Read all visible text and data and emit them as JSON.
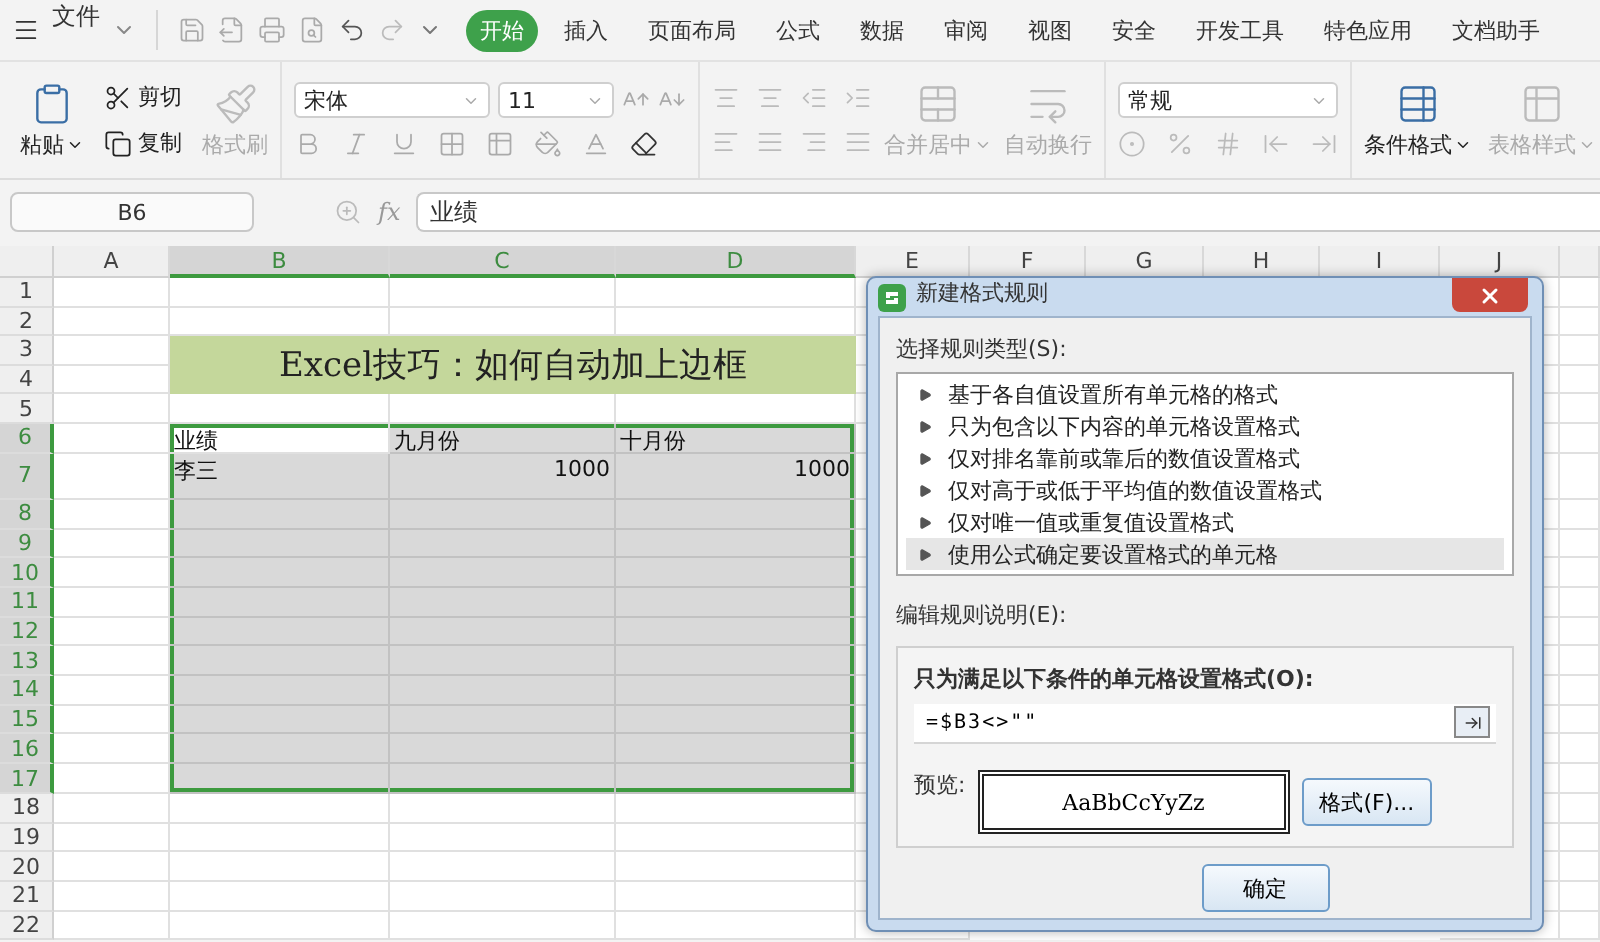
{
  "menu": {
    "file_label": "文件",
    "tabs": [
      {
        "label": "开始",
        "selected": true
      },
      {
        "label": "插入",
        "selected": false
      },
      {
        "label": "页面布局",
        "selected": false
      },
      {
        "label": "公式",
        "selected": false
      },
      {
        "label": "数据",
        "selected": false
      },
      {
        "label": "审阅",
        "selected": false
      },
      {
        "label": "视图",
        "selected": false
      },
      {
        "label": "安全",
        "selected": false
      },
      {
        "label": "开发工具",
        "selected": false
      },
      {
        "label": "特色应用",
        "selected": false
      },
      {
        "label": "文档助手",
        "selected": false
      }
    ]
  },
  "ribbon": {
    "paste": {
      "label": "粘贴",
      "disabled": false
    },
    "cut": {
      "label": "剪切",
      "disabled": false
    },
    "copy": {
      "label": "复制",
      "disabled": false
    },
    "format_painter": {
      "label": "格式刷",
      "disabled": true
    },
    "font_name": "宋体",
    "font_size": "11",
    "merge_center": {
      "label": "合并居中",
      "disabled": true
    },
    "wrap_text": {
      "label": "自动换行",
      "disabled": true
    },
    "number_format": "常规",
    "conditional_format": {
      "label": "条件格式",
      "disabled": false
    },
    "table_style": {
      "label": "表格样式",
      "disabled": true
    }
  },
  "formula_bar": {
    "name_box": "B6",
    "fx": "fx",
    "content": "业绩"
  },
  "sheet": {
    "columns": [
      {
        "label": "A",
        "selected": false
      },
      {
        "label": "B",
        "selected": true
      },
      {
        "label": "C",
        "selected": true
      },
      {
        "label": "D",
        "selected": true
      },
      {
        "label": "E",
        "selected": false
      },
      {
        "label": "F",
        "selected": false
      },
      {
        "label": "G",
        "selected": false
      },
      {
        "label": "H",
        "selected": false
      },
      {
        "label": "I",
        "selected": false
      },
      {
        "label": "J",
        "selected": false
      }
    ],
    "rows": [
      {
        "label": "1",
        "selected": false
      },
      {
        "label": "2",
        "selected": false
      },
      {
        "label": "3",
        "selected": false
      },
      {
        "label": "4",
        "selected": false
      },
      {
        "label": "5",
        "selected": false
      },
      {
        "label": "6",
        "selected": true
      },
      {
        "label": "7",
        "selected": true
      },
      {
        "label": "8",
        "selected": true
      },
      {
        "label": "9",
        "selected": true
      },
      {
        "label": "10",
        "selected": true
      },
      {
        "label": "11",
        "selected": true
      },
      {
        "label": "12",
        "selected": true
      },
      {
        "label": "13",
        "selected": true
      },
      {
        "label": "14",
        "selected": true
      },
      {
        "label": "15",
        "selected": true
      },
      {
        "label": "16",
        "selected": true
      },
      {
        "label": "17",
        "selected": true
      },
      {
        "label": "18",
        "selected": false
      },
      {
        "label": "19",
        "selected": false
      },
      {
        "label": "20",
        "selected": false
      },
      {
        "label": "21",
        "selected": false
      },
      {
        "label": "22",
        "selected": false
      }
    ],
    "banner": "Excel技巧：如何自动加上边框",
    "table": {
      "header": [
        "业绩",
        "九月份",
        "十月份"
      ],
      "rows": [
        {
          "cells": [
            "李三",
            "1000",
            "1000"
          ]
        }
      ]
    }
  },
  "dialog": {
    "title": "新建格式规则",
    "rule_type_label": "选择规则类型(S):",
    "rule_types": [
      {
        "label": "基于各自值设置所有单元格的格式",
        "selected": false
      },
      {
        "label": "只为包含以下内容的单元格设置格式",
        "selected": false
      },
      {
        "label": "仅对排名靠前或靠后的数值设置格式",
        "selected": false
      },
      {
        "label": "仅对高于或低于平均值的数值设置格式",
        "selected": false
      },
      {
        "label": "仅对唯一值或重复值设置格式",
        "selected": false
      },
      {
        "label": "使用公式确定要设置格式的单元格",
        "selected": true
      }
    ],
    "description_label": "编辑规则说明(E):",
    "condition_label": "只为满足以下条件的单元格设置格式(O):",
    "formula": "=$B3<>\"\"",
    "preview_label": "预览:",
    "preview_text": "AaBbCcYyZz",
    "format_button": "格式(F)...",
    "ok_button": "确定"
  }
}
